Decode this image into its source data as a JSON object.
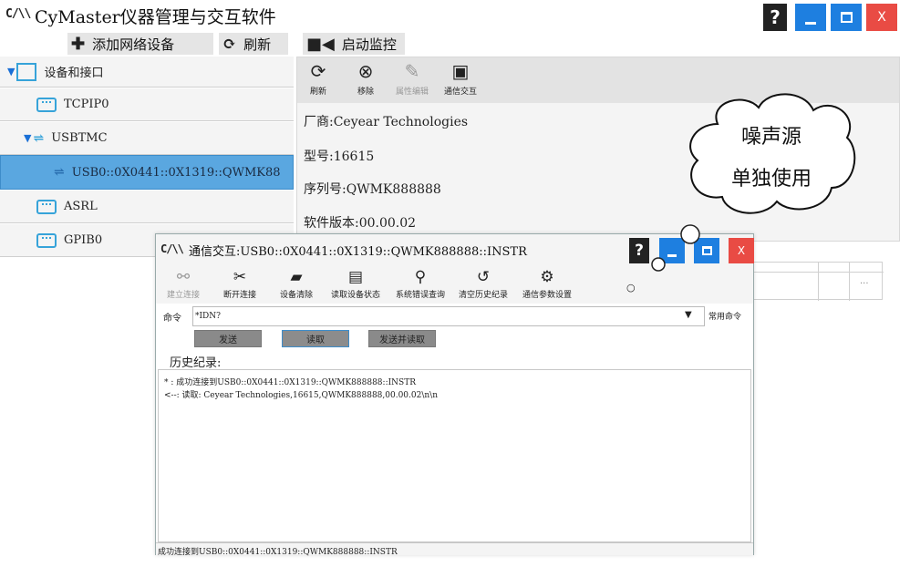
{
  "app": {
    "logo": "C/\\\\",
    "title": "CyMaster仪器管理与交互软件",
    "help": "?",
    "close": "X"
  },
  "toolbar": {
    "add_label": "添加网络设备",
    "refresh_label": "刷新",
    "monitor_label": "启动监控"
  },
  "tree": {
    "items": [
      {
        "label": "设备和接口"
      },
      {
        "label": "TCPIP0"
      },
      {
        "label": "USBTMC"
      },
      {
        "label": "USB0::0X0441::0X1319::QWMK88"
      },
      {
        "label": "ASRL"
      },
      {
        "label": "GPIB0"
      }
    ]
  },
  "device_panel": {
    "buttons": [
      {
        "label": "刷新"
      },
      {
        "label": "移除"
      },
      {
        "label": "属性编辑"
      },
      {
        "label": "通信交互"
      }
    ],
    "vendor": "厂商:Ceyear Technologies",
    "model": "型号:16615",
    "serial": "序列号:QWMK888888",
    "version": "软件版本:00.00.02"
  },
  "callout": {
    "line1": "噪声源",
    "line2": "单独使用"
  },
  "dialog": {
    "logo": "C/\\\\",
    "title": "通信交互:USB0::0X0441::0X1319::QWMK888888::INSTR",
    "help": "?",
    "close": "X",
    "toolbar": [
      {
        "label": "建立连接"
      },
      {
        "label": "断开连接"
      },
      {
        "label": "设备清除"
      },
      {
        "label": "读取设备状态"
      },
      {
        "label": "系统错误查询"
      },
      {
        "label": "清空历史纪录"
      },
      {
        "label": "通信参数设置"
      }
    ],
    "command_label": "命令",
    "command_value": "*IDN?",
    "common_commands": "常用命令",
    "send": "发送",
    "read": "读取",
    "send_read": "发送并读取",
    "history_label": "历史纪录:",
    "history": [
      "* : 成功连接到USB0::0X0441::0X1319::QWMK888888::INSTR",
      "<--: 读取: Ceyear Technologies,16615,QWMK888888,00.00.02\\n\\n"
    ],
    "status": "成功连接到USB0::0X0441::0X1319::QWMK888888::INSTR"
  },
  "colors": {
    "accent": "#1e7fe0",
    "close": "#e94b44",
    "selected": "#5aa7e0"
  }
}
